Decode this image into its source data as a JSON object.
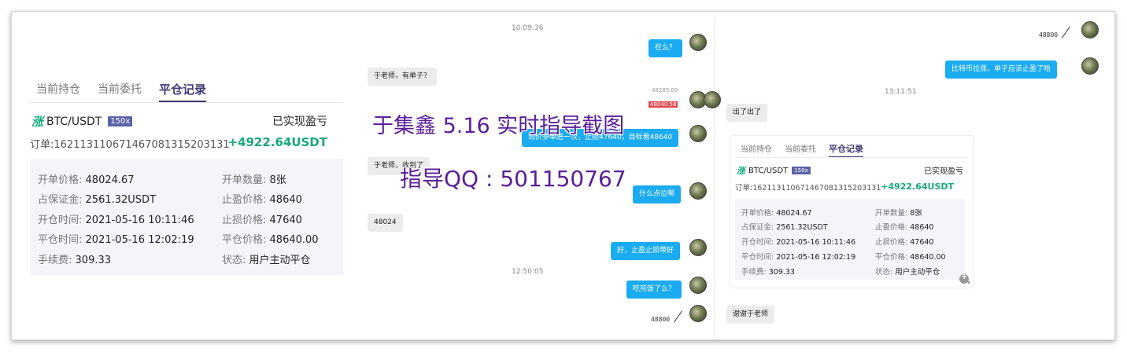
{
  "trade_card": {
    "tabs": [
      "当前持仓",
      "当前委托",
      "平仓记录"
    ],
    "active_tab": "平仓记录",
    "direction_tag": "涨",
    "pair": "BTC/USDT",
    "leverage": "150x",
    "realized_label": "已实现盈亏",
    "order_id": "订单:162113110671467081315203131",
    "profit": "+4922.64USDT",
    "details": {
      "open_price_label": "开单价格:",
      "open_price": "48024.67",
      "open_qty_label": "开单数量:",
      "open_qty": "8张",
      "margin_label": "占保证金:",
      "margin": "2561.32USDT",
      "tp_label": "止盈价格:",
      "tp": "48640",
      "open_time_label": "开仓时间:",
      "open_time": "2021-05-16 10:11:46",
      "sl_label": "止损价格:",
      "sl": "47640",
      "close_time_label": "平仓时间:",
      "close_time": "2021-05-16 12:02:19",
      "close_price_label": "平仓价格:",
      "close_price": "48640.00",
      "fee_label": "手续费:",
      "fee": "309.33",
      "status_label": "状态:",
      "status": "用户主动平仓"
    }
  },
  "chat1": {
    "ts1": "10:09:36",
    "m1": "在么？",
    "m2": "于老师，有单子？",
    "chart_price": "48040.58",
    "chart_price_top": "48285.00",
    "m3": "现价多单进一次，止损47640，目标看48640",
    "m4": "于老师，收到了",
    "m5": "什么点位啊",
    "m6": "48024",
    "m7": "好，止盈止损带好",
    "ts2": "12:50:05",
    "m8": "吃完饭了么？",
    "sticker": "48800"
  },
  "chat2": {
    "sticker": "48800",
    "m1": "比特币拉涨，单子应该止盈了哈",
    "ts1": "13:11:51",
    "m2": "出了出了",
    "m3": "谢谢于老师"
  },
  "watermark": {
    "line1": "于集鑫 5.16 实时指导截图",
    "line2": "指导QQ : 501150767"
  }
}
